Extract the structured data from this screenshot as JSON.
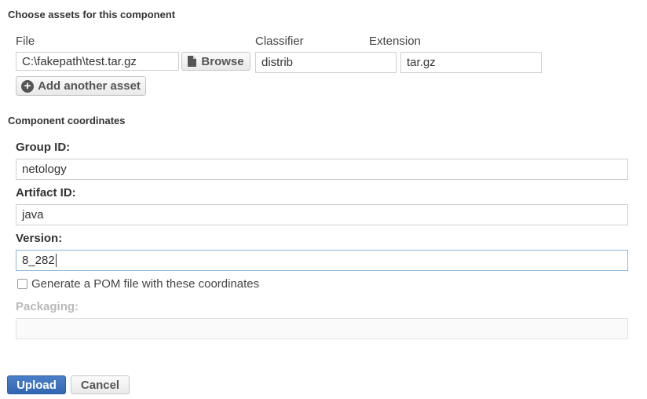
{
  "assets": {
    "section_title": "Choose assets for this component",
    "columns": {
      "file": "File",
      "classifier": "Classifier",
      "extension": "Extension"
    },
    "row": {
      "file_value": "C:\\fakepath\\test.tar.gz",
      "browse_label": "Browse",
      "classifier_value": "distrib",
      "extension_value": "tar.gz"
    },
    "add_asset_label": "Add another asset"
  },
  "coordinates": {
    "section_title": "Component coordinates",
    "group_id": {
      "label": "Group ID:",
      "value": "netology"
    },
    "artifact_id": {
      "label": "Artifact ID:",
      "value": "java"
    },
    "version": {
      "label": "Version:",
      "value": "8_282"
    },
    "generate_pom": {
      "label": "Generate a POM file with these coordinates",
      "checked": false
    },
    "packaging": {
      "label": "Packaging:",
      "value": ""
    }
  },
  "actions": {
    "upload_label": "Upload",
    "cancel_label": "Cancel"
  },
  "colors": {
    "primary": "#3a6fbc",
    "disabled_text": "#b9b9b9",
    "focus_border": "#8fb5da"
  },
  "icons": {
    "browse": "file-icon",
    "add_asset": "plus-circle-icon"
  }
}
